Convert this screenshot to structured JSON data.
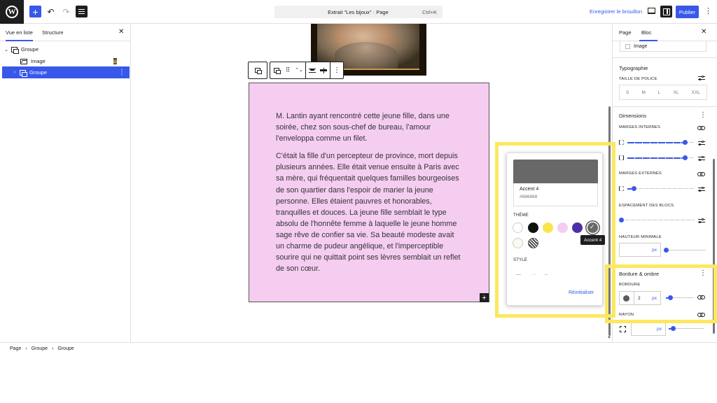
{
  "topbar": {
    "logo": "W",
    "add_icon": "+",
    "undo_icon": "↶",
    "redo_icon": "↷",
    "command": {
      "title": "Extrait \"Les bijoux\" · Page",
      "shortcut": "Ctrl+K"
    },
    "save_draft": "Enregistrer le brouillon",
    "publish": "Publier",
    "more_icon": "⋮"
  },
  "left_panel": {
    "tabs": [
      "Vue en liste",
      "Structure"
    ],
    "close_icon": "✕",
    "tree": [
      {
        "label": "Groupe",
        "chev": "⌄"
      },
      {
        "label": "Image",
        "chev": ""
      },
      {
        "label": "Groupe",
        "chev": "›",
        "more": "⋮"
      }
    ]
  },
  "canvas": {
    "paragraphs": [
      "M. Lantin ayant rencontré cette jeune fille, dans une soirée, chez son sous-chef de bureau, l'amour l'enveloppa comme un filet.",
      "C'était la fille d'un percepteur de province, mort depuis plusieurs années. Elle était venue ensuite à Paris avec sa mère, qui fréquentait quelques familles bourgeoises de son quartier dans l'espoir de marier la jeune personne. Elles étaient pauvres et honorables, tranquilles et douces. La jeune fille semblait le type absolu de l'honnête femme à laquelle le jeune homme sage rêve de confier sa vie. Sa beauté modeste avait un charme de pudeur angélique, et l'imperceptible sourire qui ne quittait point ses lèvres semblait un reflet de son cœur."
    ],
    "inserter_icon": "+",
    "toolbar": {
      "drag_icon": "⠿",
      "move_icon": "⌃⌄",
      "more_icon": "⋮"
    }
  },
  "color_popover": {
    "selected": {
      "name": "Accent 4",
      "hex": "#686868"
    },
    "theme_label": "Thème",
    "palette": [
      "#ffffff",
      "#111111",
      "#fbe54d",
      "#f5cdf1",
      "#4d2fa6",
      "#686868",
      "#fbfaf1",
      "hatch"
    ],
    "check_icon": "✓",
    "tooltip": "Accent 4",
    "style_label": "Style",
    "style_options": [
      "—",
      "···",
      "┄"
    ],
    "reset": "Réinitialiser"
  },
  "right_panel": {
    "tabs": [
      "Page",
      "Bloc"
    ],
    "close_icon": "✕",
    "image_row": "Image",
    "typography": {
      "title": "Typographie",
      "font_size_label": "Taille de police",
      "sizes": [
        "S",
        "M",
        "L",
        "XL",
        "XXL"
      ]
    },
    "dimensions": {
      "title": "Dimensions",
      "padding_label": "Marges internes",
      "padding_values": [
        0.82,
        0.82
      ],
      "margin_label": "Marges externes",
      "margin_value": 0.06,
      "spacing_label": "Espacement des blocs",
      "spacing_value": 0.0,
      "min_height_label": "Hauteur minimale",
      "min_height_unit": "px"
    },
    "border": {
      "title": "Bordure & ombre",
      "border_label": "Bordure",
      "width_value": "2",
      "width_unit": "px",
      "width_slider": 0.07,
      "radius_label": "Rayon",
      "radius_unit": "px",
      "radius_slider": 0.05
    },
    "more_icon": "⋮"
  },
  "footer": {
    "breadcrumbs": [
      "Page",
      "Groupe",
      "Groupe"
    ],
    "sep": "›"
  },
  "colors": {
    "accent": "#3858e9",
    "highlight": "#fbe85f",
    "block_bg": "#f5cdf1"
  }
}
